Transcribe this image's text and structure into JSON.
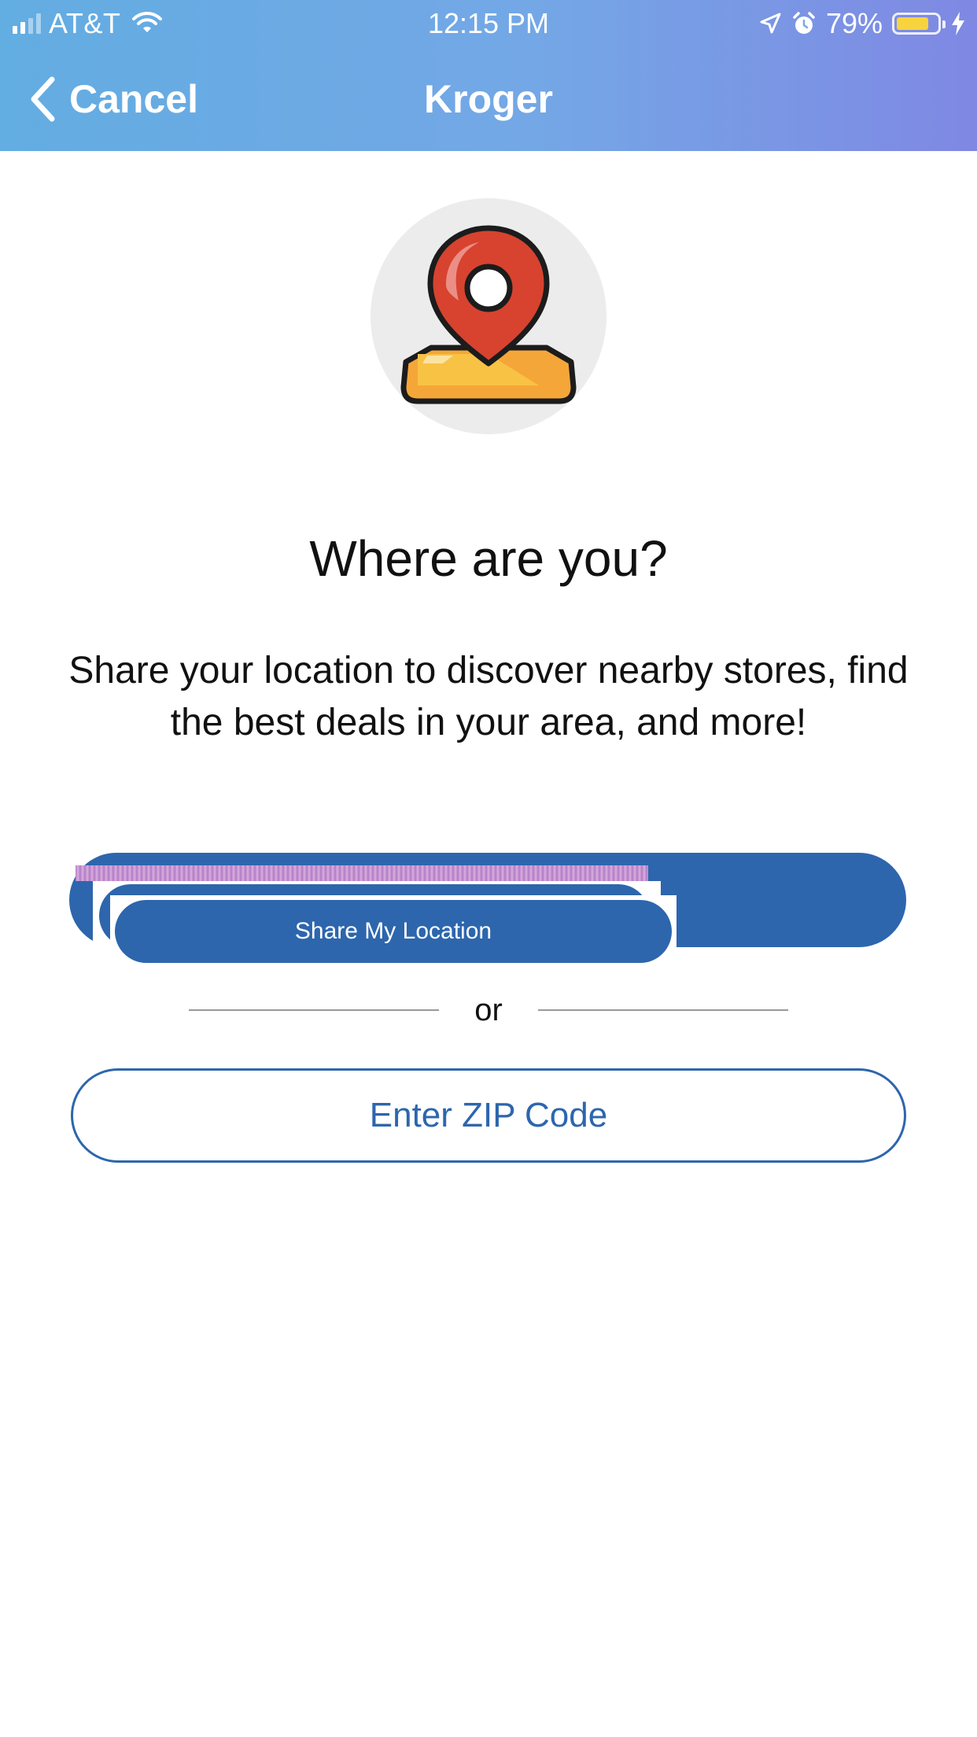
{
  "status_bar": {
    "carrier": "AT&T",
    "time": "12:15 PM",
    "battery_percent": "79%",
    "battery_level": 0.79,
    "signal_bars_active": 2,
    "signal_bars_total": 4,
    "icons": [
      "signal-icon",
      "wifi-icon",
      "location-arrow-icon",
      "alarm-icon",
      "battery-icon",
      "charging-bolt-icon"
    ]
  },
  "nav": {
    "back_label": "Cancel",
    "back_icon": "chevron-left-icon",
    "title": "Kroger"
  },
  "hero": {
    "icon": "map-pin-icon"
  },
  "main": {
    "heading": "Where are you?",
    "subtitle": "Share your location to discover nearby stores, find the best deals in your area, and more!",
    "share_button_label": "Share My Location",
    "divider_label": "or",
    "zip_button_label": "Enter ZIP Code"
  },
  "colors": {
    "header_gradient_start": "#62ade2",
    "header_gradient_end": "#7f88e3",
    "primary_blue": "#2d66ad",
    "battery_yellow": "#f7d33e",
    "hero_circle": "#ececec",
    "pin_red": "#d7432f",
    "base_orange": "#f39a34"
  }
}
